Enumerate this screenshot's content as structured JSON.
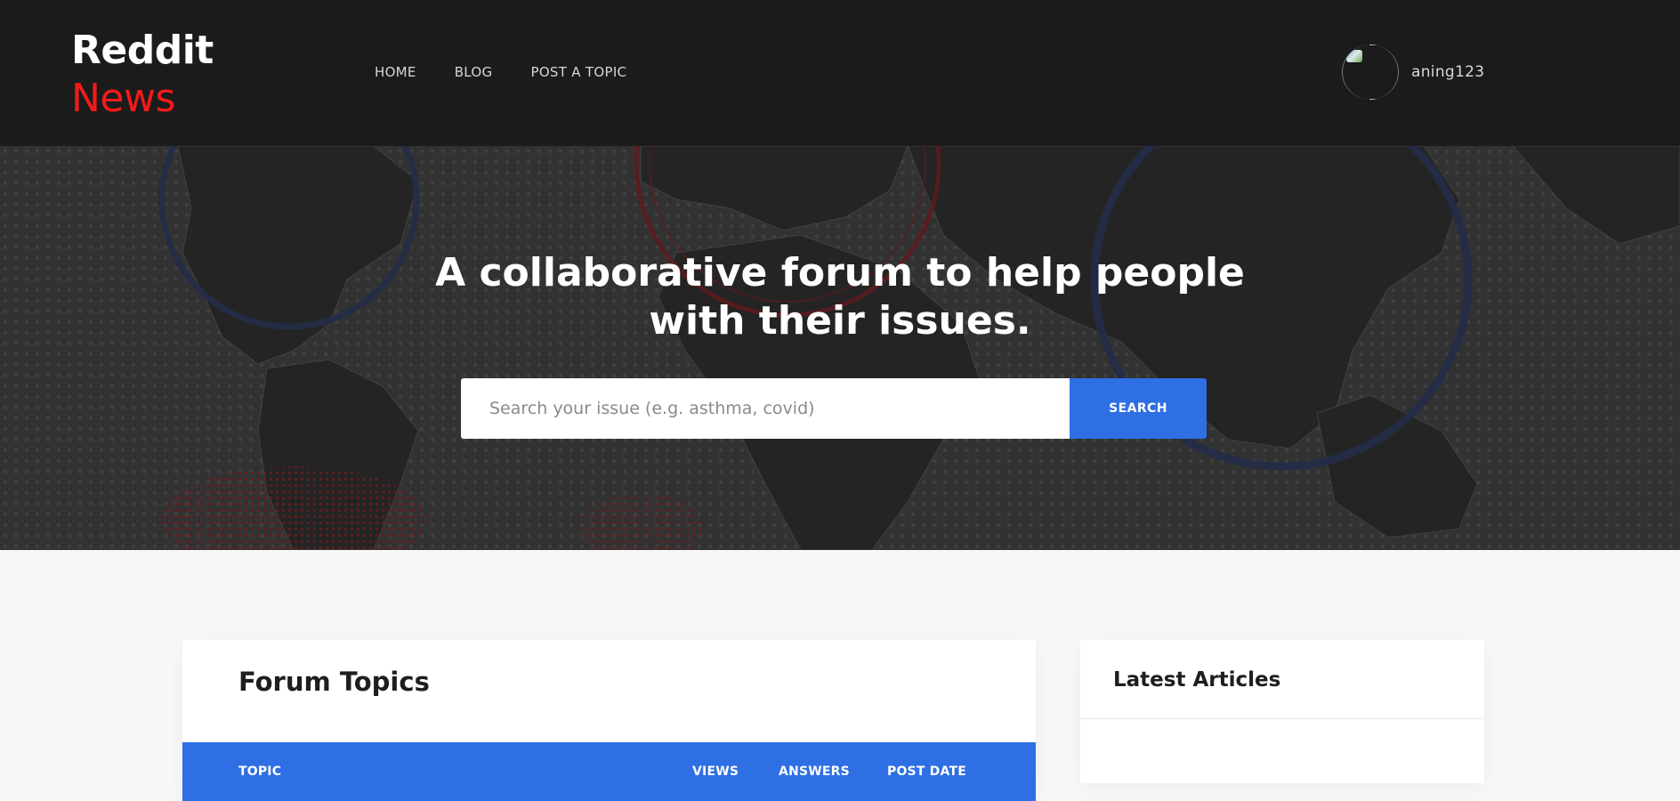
{
  "brand": {
    "line1": "Reddit",
    "line2": "News",
    "accent_color": "#f21b1b"
  },
  "nav": {
    "items": [
      "HOME",
      "BLOG",
      "POST A TOPIC"
    ]
  },
  "user": {
    "username": "aning123",
    "avatar_icon": "broken-image-avatar"
  },
  "hero": {
    "title": "A collaborative forum to help people with their issues.",
    "search": {
      "placeholder": "Search your issue (e.g. asthma, covid)",
      "value": "",
      "button_label": "SEARCH"
    },
    "background": "world-map"
  },
  "forum": {
    "title": "Forum Topics",
    "columns": [
      "TOPIC",
      "VIEWS",
      "ANSWERS",
      "POST DATE"
    ]
  },
  "articles": {
    "title": "Latest Articles"
  },
  "colors": {
    "header_bg": "#1b1b1b",
    "primary": "#2e6fe3",
    "page_bg": "#f8f8f8"
  }
}
